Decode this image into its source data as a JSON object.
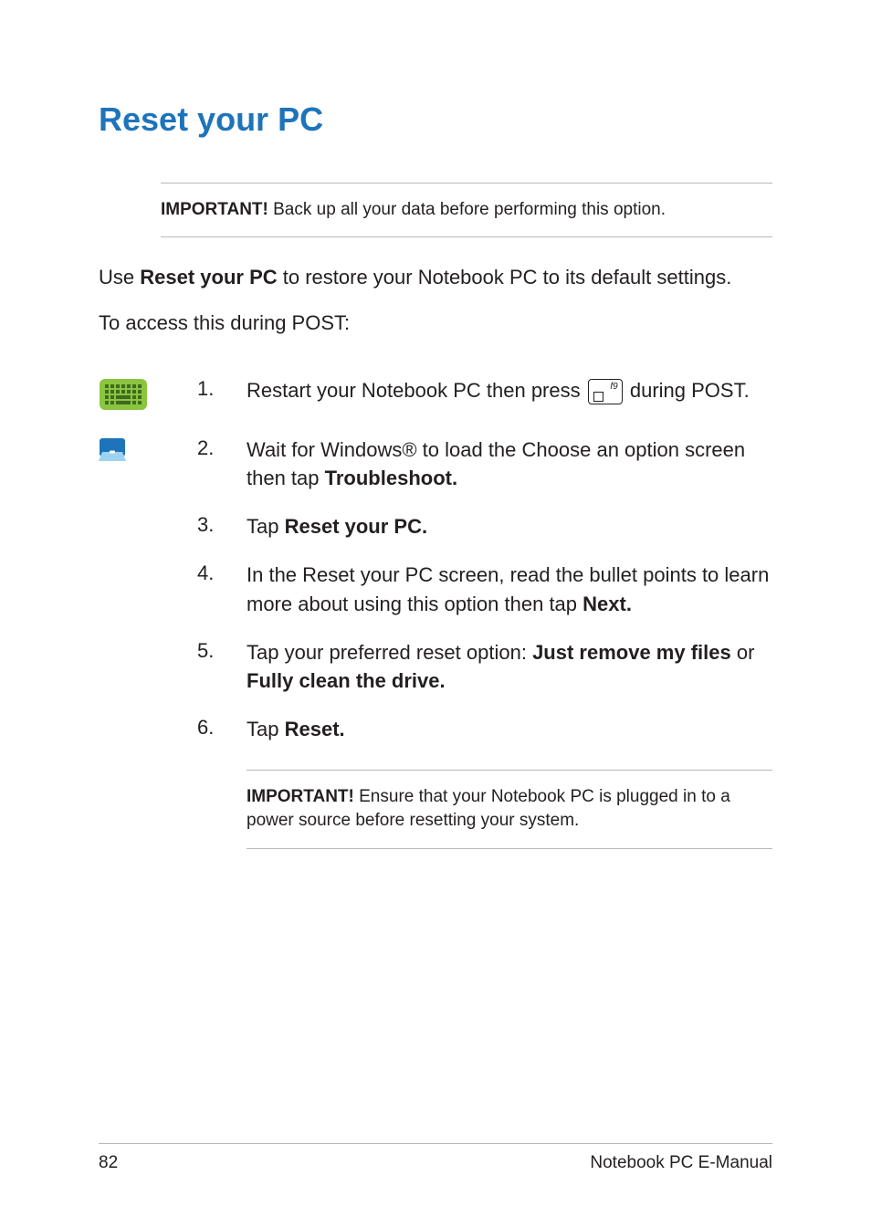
{
  "heading": "Reset your PC",
  "callout_top_label": "IMPORTANT!",
  "callout_top_text": " Back up all your data before performing this option.",
  "intro_pre": "Use ",
  "intro_bold": "Reset your PC",
  "intro_post": " to restore your Notebook PC to its default settings.",
  "access_text": "To access this during POST:",
  "key_label": "f9",
  "steps": [
    {
      "num": "1.",
      "pre": "Restart your Notebook PC then press ",
      "post": " during POST."
    },
    {
      "num": "2.",
      "pre": "Wait for Windows® to load the Choose an option screen then tap ",
      "bold": "Troubleshoot."
    },
    {
      "num": "3.",
      "pre": "Tap ",
      "bold": "Reset your PC."
    },
    {
      "num": "4.",
      "pre": "In the Reset your PC screen, read the bullet points to learn more about using this option then tap ",
      "bold": "Next."
    },
    {
      "num": "5.",
      "pre": "Tap your preferred reset option: ",
      "bold": "Just remove my files",
      "mid": " or ",
      "bold2": "Fully clean the drive."
    },
    {
      "num": "6.",
      "pre": "Tap ",
      "bold": "Reset."
    }
  ],
  "callout_bottom_label": "IMPORTANT!",
  "callout_bottom_text": " Ensure that your Notebook PC is plugged in to a power source before resetting your system.",
  "footer_page": "82",
  "footer_title": "Notebook PC E-Manual"
}
